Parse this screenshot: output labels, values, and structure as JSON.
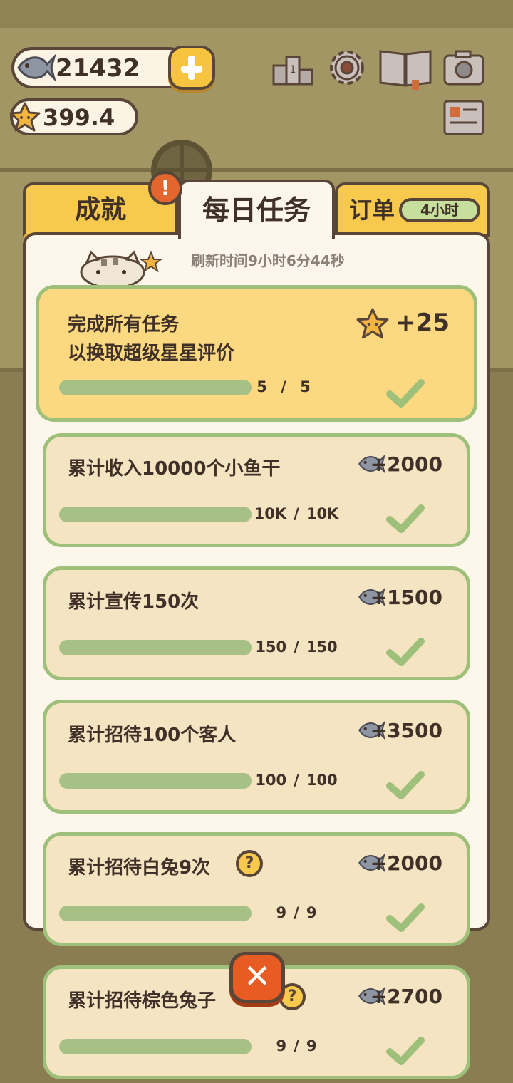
{
  "hud": {
    "fish_count": "21432",
    "star_rating": "399.4",
    "icons": [
      "ranking-icon",
      "gear-icon",
      "book-icon",
      "camera-icon"
    ]
  },
  "tabs": {
    "achievements": "成就",
    "daily_tasks": "每日任务",
    "orders": "订单",
    "orders_timer": "4小时",
    "alert": "!"
  },
  "refresh_text": "刷新时间9小时6分44秒",
  "main_task": {
    "title_line1": "完成所有任务",
    "title_line2": "以换取超级星星评价",
    "reward": "+25",
    "progress_current": "5",
    "progress_total": "5",
    "progress_fraction": 1.0
  },
  "tasks": [
    {
      "title": "累计收入10000个小鱼干",
      "reward": "+2000",
      "current": "10K",
      "total": "10K",
      "fraction": 1.0
    },
    {
      "title": "累计宣传150次",
      "reward": "+1500",
      "current": "150",
      "total": "150",
      "fraction": 1.0
    },
    {
      "title": "累计招待100个客人",
      "reward": "+3500",
      "current": "100",
      "total": "100",
      "fraction": 1.0
    },
    {
      "title": "累计招待白兔9次",
      "reward": "+2000",
      "current": "9",
      "total": "9",
      "fraction": 1.0
    },
    {
      "title": "累计招待棕色兔子",
      "reward": "+2700",
      "current": "9",
      "total": "9",
      "fraction": 1.0
    }
  ],
  "close_label": "✕",
  "qmark": "?",
  "slash": "/",
  "colors": {
    "accent_yellow": "#f7c94c",
    "card_border_green": "#9fc07a",
    "progress_green": "#a7c085",
    "close_orange": "#e85c24",
    "outline_brown": "#5a4638"
  }
}
